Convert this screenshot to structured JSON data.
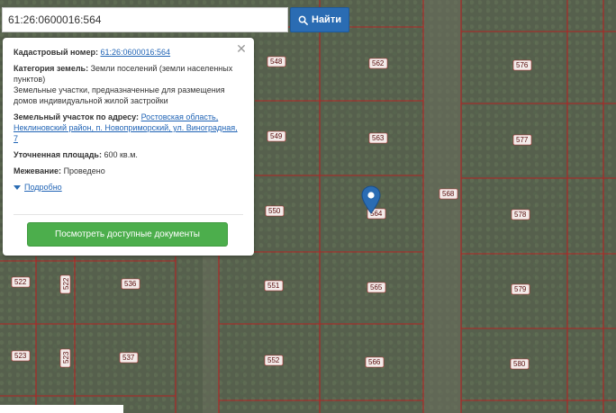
{
  "search": {
    "value": "61:26:0600016:564",
    "button_label": "Найти",
    "button_icon": "search-icon"
  },
  "popup": {
    "cadastral_label": "Кадастровый номер:",
    "cadastral_value": "61:26:0600016:564",
    "category_label": "Категория земель:",
    "category_value": "Земли поселений (земли населенных пунктов)",
    "category_desc": "Земельные участки, предназначенные для размещения домов индивидуальной жилой застройки",
    "address_label": "Земельный участок по адресу:",
    "address_value": "Ростовская область, Неклиновский район, п. Новоприморский, ул. Виноградная, 7",
    "area_label": "Уточненная площадь:",
    "area_value": "600 кв.м.",
    "survey_label": "Межевание:",
    "survey_value": "Проведено",
    "details_link": "Подробно",
    "docs_button": "Посмотреть доступные документы",
    "close_icon": "close-icon"
  },
  "map": {
    "parcel_color": "#b32424",
    "marker_color": "#2a6cb3",
    "marker_icon": "map-pin-icon",
    "plot_labels": [
      "548",
      "562",
      "576",
      "549",
      "563",
      "577",
      "550",
      "564",
      "568",
      "578",
      "522",
      "522",
      "536",
      "551",
      "565",
      "579",
      "523",
      "523",
      "537",
      "552",
      "566",
      "580"
    ]
  },
  "colors": {
    "search_button": "#2a6cb3",
    "docs_button": "#4cae4c",
    "link": "#1f63b5"
  }
}
